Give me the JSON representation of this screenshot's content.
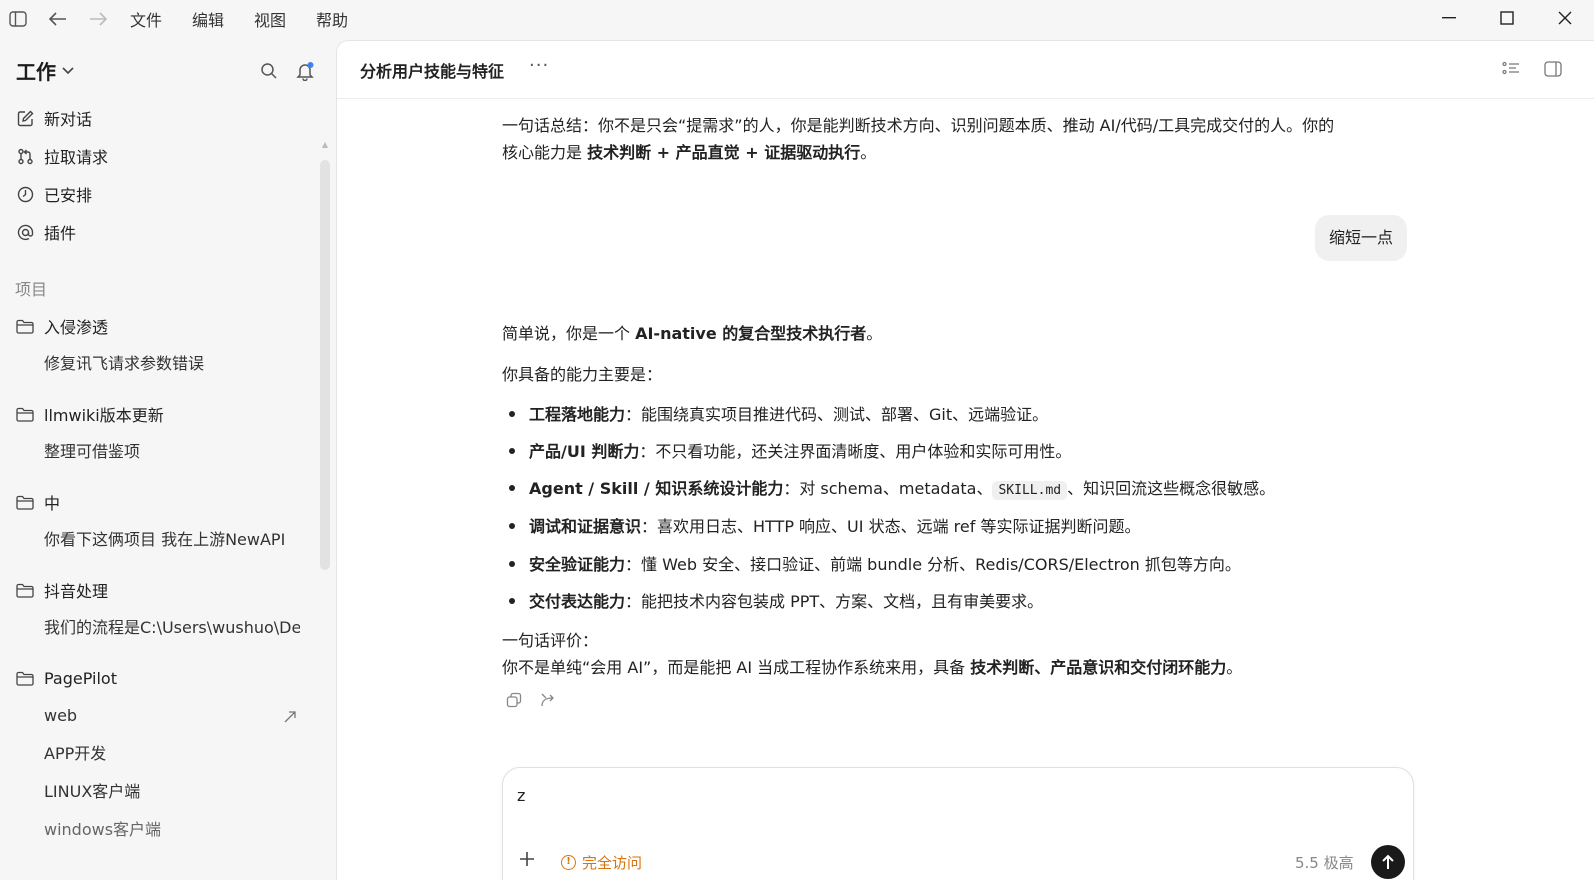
{
  "menu": [
    "文件",
    "编辑",
    "视图",
    "帮助"
  ],
  "sidebar": {
    "workspace": "工作",
    "nav": [
      {
        "label": "新对话",
        "icon": "edit-icon"
      },
      {
        "label": "拉取请求",
        "icon": "pull-request-icon"
      },
      {
        "label": "已安排",
        "icon": "clock-icon"
      },
      {
        "label": "插件",
        "icon": "at-icon"
      }
    ],
    "section_label": "项目",
    "projects": [
      {
        "name": "入侵渗透",
        "threads": [
          "修复讯飞请求参数错误"
        ]
      },
      {
        "name": "llmwiki版本更新",
        "threads": [
          "整理可借鉴项"
        ]
      },
      {
        "name": "中",
        "threads": [
          "你看下这俩项目 我在上游NewAPI"
        ]
      },
      {
        "name": "抖音处理",
        "threads": [
          "我们的流程是C:\\Users\\wushuo\\Desktop"
        ]
      },
      {
        "name": "PagePilot",
        "threads": [
          "web",
          "APP开发",
          "LINUX客户端",
          "windows客户端"
        ]
      }
    ]
  },
  "conversation": {
    "title": "分析用户技能与特征",
    "summary_line1": "一句话总结：你不是只会“提需求”的人，你是能判断技术方向、识别问题本质、推动 AI/代码/工具完成交付的人。你的",
    "summary_line2_pre": "核心能力是 ",
    "summary_line2_bold": "技术判断 + 产品直觉 + 证据驱动执行",
    "summary_line2_post": "。",
    "user_message": "缩短一点",
    "intro_pre": "简单说，你是一个 ",
    "intro_bold": "AI-native 的复合型技术执行者",
    "intro_post": "。",
    "abilities_heading": "你具备的能力主要是：",
    "bullets": [
      {
        "title": "工程落地能力",
        "text": "：能围绕真实项目推进代码、测试、部署、Git、远端验证。"
      },
      {
        "title": "产品/UI 判断力",
        "text": "：不只看功能，还关注界面清晰度、用户体验和实际可用性。"
      },
      {
        "title": "Agent / Skill / 知识系统设计能力",
        "text_pre": "：对 schema、metadata、",
        "code": "SKILL.md",
        "text_post": "、知识回流这些概念很敏感。"
      },
      {
        "title": "调试和证据意识",
        "text": "：喜欢用日志、HTTP 响应、UI 状态、远端 ref 等实际证据判断问题。"
      },
      {
        "title": "安全验证能力",
        "text": "：懂 Web 安全、接口验证、前端 bundle 分析、Redis/CORS/Electron 抓包等方向。"
      },
      {
        "title": "交付表达能力",
        "text": "：能把技术内容包装成 PPT、方案、文档，且有审美要求。"
      }
    ],
    "eval_heading": "一句话评价：",
    "eval_pre": "你不是单纯“会用 AI”，而是能把 AI 当成工程协作系统来用，具备 ",
    "eval_bold": "技术判断、产品意识和交付闭环能力",
    "eval_post": "。"
  },
  "composer": {
    "value": "z",
    "access_label": "完全访问",
    "model_label": "5.5  极高"
  },
  "colors": {
    "accent_warning": "#d9730d",
    "send_button": "#1a1a1a",
    "notification_dot": "#3b82f6"
  }
}
